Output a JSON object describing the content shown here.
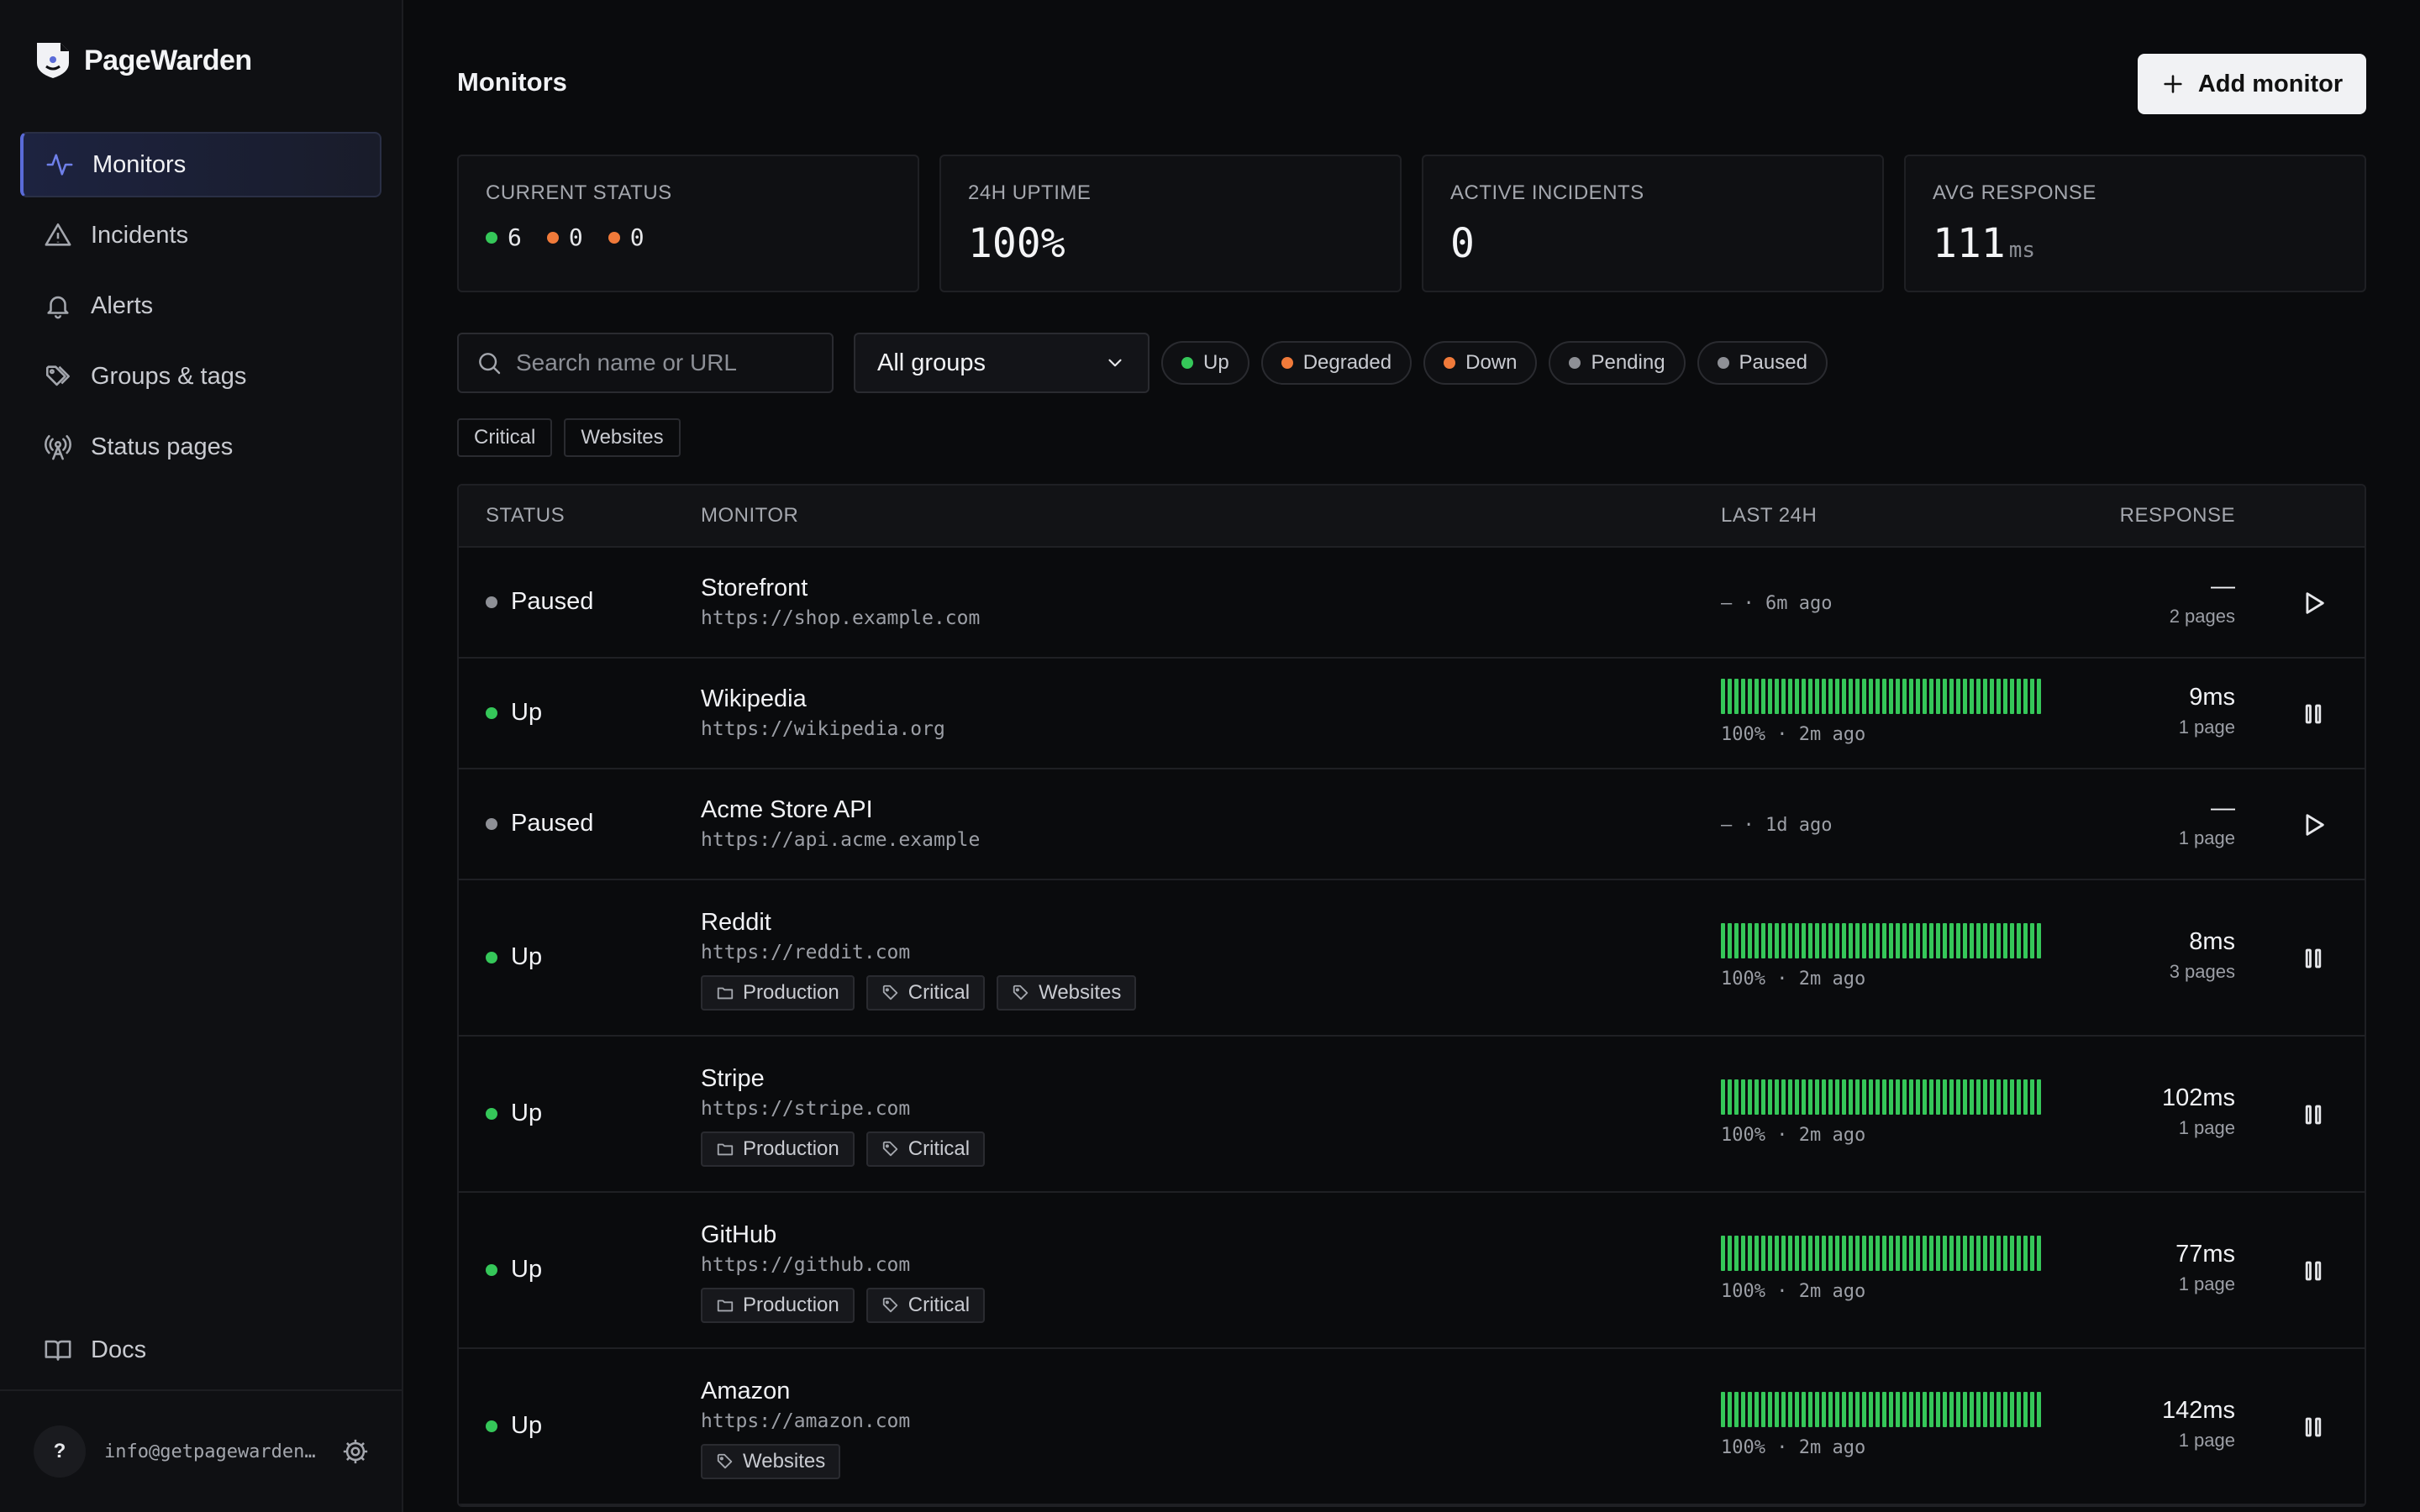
{
  "brand": {
    "name": "PageWarden"
  },
  "sidebar": {
    "items": [
      {
        "label": "Monitors",
        "icon": "activity-icon",
        "active": true
      },
      {
        "label": "Incidents",
        "icon": "warning-icon"
      },
      {
        "label": "Alerts",
        "icon": "bell-icon"
      },
      {
        "label": "Groups & tags",
        "icon": "tags-icon"
      },
      {
        "label": "Status pages",
        "icon": "broadcast-icon"
      }
    ],
    "docs": "Docs",
    "user": {
      "initial": "?",
      "email": "info@getpagewarden.com"
    }
  },
  "header": {
    "title": "Monitors",
    "add_label": "Add monitor"
  },
  "cards": {
    "status": {
      "label": "CURRENT STATUS",
      "up": "6",
      "degraded": "0",
      "down": "0"
    },
    "uptime": {
      "label": "24H UPTIME",
      "value": "100%"
    },
    "incidents": {
      "label": "ACTIVE INCIDENTS",
      "value": "0"
    },
    "response": {
      "label": "AVG RESPONSE",
      "value": "111",
      "unit": "ms"
    }
  },
  "filters": {
    "search_placeholder": "Search name or URL",
    "group": "All groups",
    "chips": [
      "Up",
      "Degraded",
      "Down",
      "Pending",
      "Paused"
    ],
    "tags": [
      "Critical",
      "Websites"
    ]
  },
  "table": {
    "headers": {
      "status": "STATUS",
      "monitor": "MONITOR",
      "last24": "LAST 24H",
      "response": "RESPONSE"
    },
    "rows": [
      {
        "status": "Paused",
        "name": "Storefront",
        "url": "https://shop.example.com",
        "uptime": "",
        "meta": "— · 6m ago",
        "response": "—",
        "pages": "2 pages",
        "tags": [],
        "action": "play"
      },
      {
        "status": "Up",
        "name": "Wikipedia",
        "url": "https://wikipedia.org",
        "uptime": "100%",
        "meta": "100% · 2m ago",
        "response": "9ms",
        "pages": "1 page",
        "tags": [],
        "action": "pause"
      },
      {
        "status": "Paused",
        "name": "Acme Store API",
        "url": "https://api.acme.example",
        "uptime": "",
        "meta": "— · 1d ago",
        "response": "—",
        "pages": "1 page",
        "tags": [],
        "action": "play"
      },
      {
        "status": "Up",
        "name": "Reddit",
        "url": "https://reddit.com",
        "uptime": "100%",
        "meta": "100% · 2m ago",
        "response": "8ms",
        "pages": "3 pages",
        "tags": [
          {
            "label": "Production",
            "kind": "folder"
          },
          {
            "label": "Critical",
            "kind": "tag"
          },
          {
            "label": "Websites",
            "kind": "tag"
          }
        ],
        "action": "pause"
      },
      {
        "status": "Up",
        "name": "Stripe",
        "url": "https://stripe.com",
        "uptime": "100%",
        "meta": "100% · 2m ago",
        "response": "102ms",
        "pages": "1 page",
        "tags": [
          {
            "label": "Production",
            "kind": "folder"
          },
          {
            "label": "Critical",
            "kind": "tag"
          }
        ],
        "action": "pause"
      },
      {
        "status": "Up",
        "name": "GitHub",
        "url": "https://github.com",
        "uptime": "100%",
        "meta": "100% · 2m ago",
        "response": "77ms",
        "pages": "1 page",
        "tags": [
          {
            "label": "Production",
            "kind": "folder"
          },
          {
            "label": "Critical",
            "kind": "tag"
          }
        ],
        "action": "pause"
      },
      {
        "status": "Up",
        "name": "Amazon",
        "url": "https://amazon.com",
        "uptime": "100%",
        "meta": "100% · 2m ago",
        "response": "142ms",
        "pages": "1 page",
        "tags": [
          {
            "label": "Websites",
            "kind": "tag"
          }
        ],
        "action": "pause"
      }
    ]
  },
  "colors": {
    "up": "#35c759",
    "degraded": "#f07a3a",
    "down": "#f07a3a",
    "pending": "#8e9096",
    "paused": "#8e9096",
    "accent": "#5a6bd8"
  }
}
